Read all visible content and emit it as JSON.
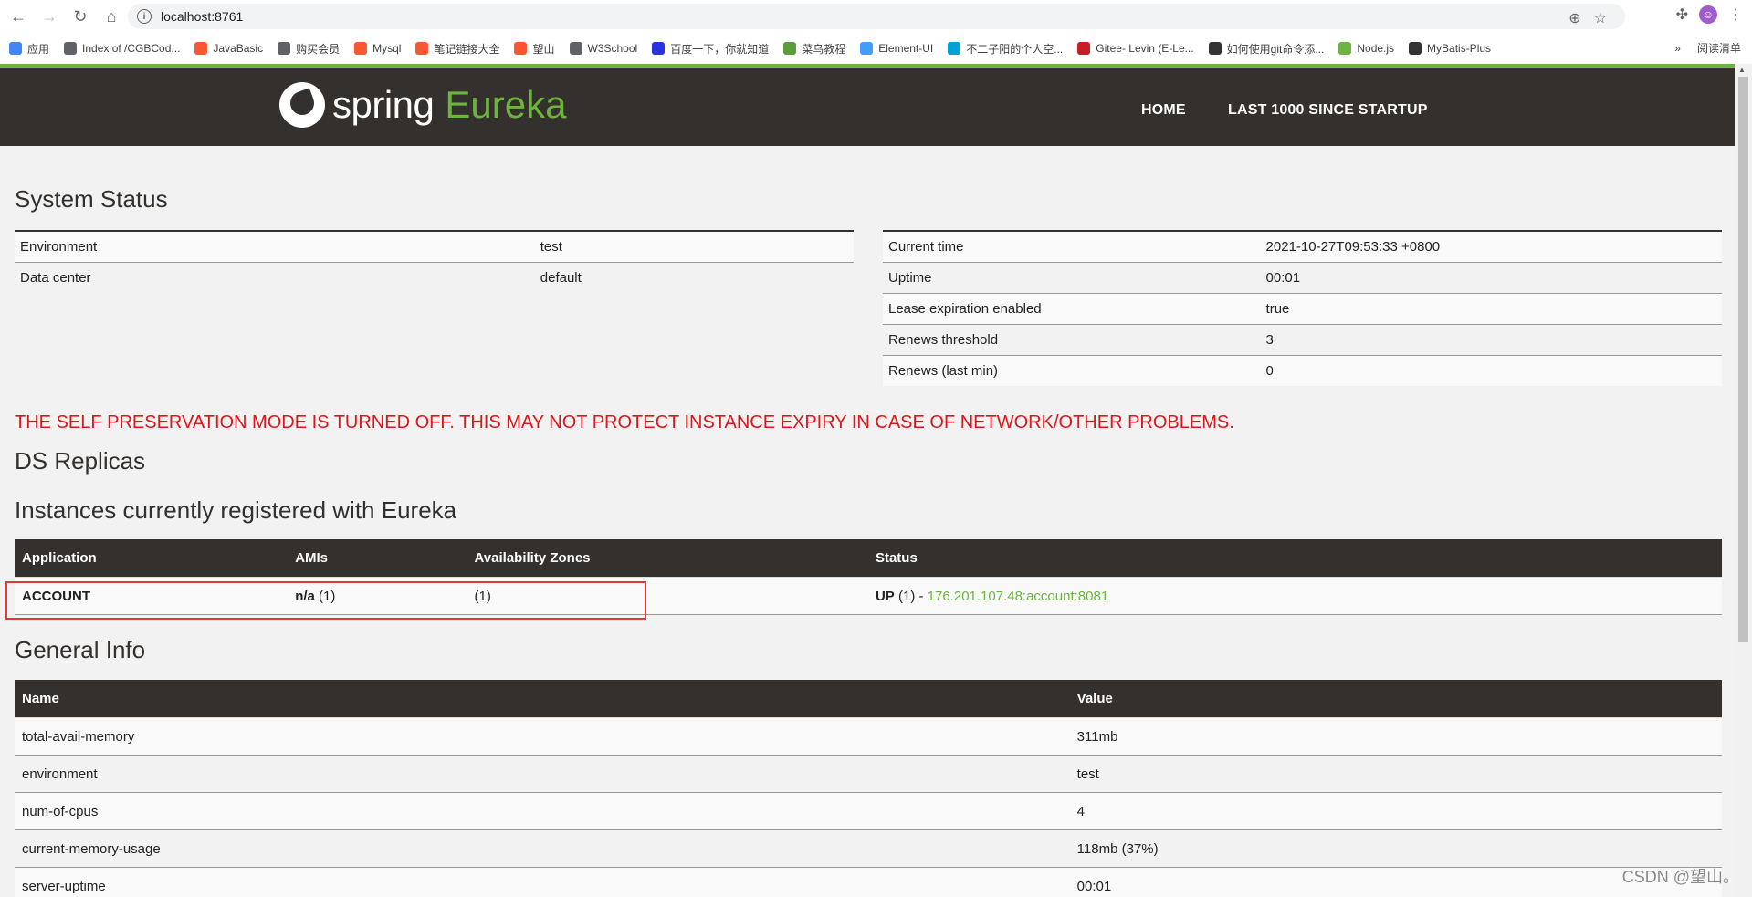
{
  "browser": {
    "url": "localhost:8761",
    "bookmarks": [
      {
        "label": "应用",
        "icon": "apps-icon",
        "color": "#4285f4"
      },
      {
        "label": "Index of /CGBCod...",
        "icon": "globe-icon",
        "color": "#5f6368"
      },
      {
        "label": "JavaBasic",
        "icon": "csdn-icon",
        "color": "#fc5531"
      },
      {
        "label": "购买会员",
        "icon": "globe-icon",
        "color": "#5f6368"
      },
      {
        "label": "Mysql",
        "icon": "csdn-icon",
        "color": "#fc5531"
      },
      {
        "label": "笔记链接大全",
        "icon": "csdn-icon",
        "color": "#fc5531"
      },
      {
        "label": "望山",
        "icon": "csdn-icon",
        "color": "#fc5531"
      },
      {
        "label": "W3School",
        "icon": "globe-icon",
        "color": "#5f6368"
      },
      {
        "label": "百度一下，你就知道",
        "icon": "baidu-icon",
        "color": "#2932e1"
      },
      {
        "label": "菜鸟教程",
        "icon": "runoob-icon",
        "color": "#5a9e3b"
      },
      {
        "label": "Element-UI",
        "icon": "element-icon",
        "color": "#409eff"
      },
      {
        "label": "不二子阳的个人空...",
        "icon": "bilibili-icon",
        "color": "#00a1d6"
      },
      {
        "label": "Gitee- Levin (E-Le...",
        "icon": "gitee-icon",
        "color": "#c71d23"
      },
      {
        "label": "如何使用git命令添...",
        "icon": "git-icon",
        "color": "#333333"
      },
      {
        "label": "Node.js",
        "icon": "nodejs-icon",
        "color": "#6db33f"
      },
      {
        "label": "MyBatis-Plus",
        "icon": "mybatis-icon",
        "color": "#333333"
      }
    ],
    "reading_list": "阅读清单",
    "more": "»"
  },
  "header": {
    "logo_spring": "spring",
    "logo_eureka": "Eureka",
    "nav": [
      "HOME",
      "LAST 1000 SINCE STARTUP"
    ]
  },
  "system_status": {
    "title": "System Status",
    "left": [
      {
        "k": "Environment",
        "v": "test"
      },
      {
        "k": "Data center",
        "v": "default"
      }
    ],
    "right": [
      {
        "k": "Current time",
        "v": "2021-10-27T09:53:33 +0800"
      },
      {
        "k": "Uptime",
        "v": "00:01"
      },
      {
        "k": "Lease expiration enabled",
        "v": "true"
      },
      {
        "k": "Renews threshold",
        "v": "3"
      },
      {
        "k": "Renews (last min)",
        "v": "0"
      }
    ]
  },
  "warning": "THE SELF PRESERVATION MODE IS TURNED OFF. THIS MAY NOT PROTECT INSTANCE EXPIRY IN CASE OF NETWORK/OTHER PROBLEMS.",
  "ds_replicas": "DS Replicas",
  "instances": {
    "title": "Instances currently registered with Eureka",
    "headers": [
      "Application",
      "AMIs",
      "Availability Zones",
      "Status"
    ],
    "rows": [
      {
        "app": "ACCOUNT",
        "ami": "n/a",
        "ami_count": "(1)",
        "zones": "(1)",
        "status": "UP",
        "status_count": "(1) - ",
        "link": "176.201.107.48:account:8081"
      }
    ]
  },
  "general_info": {
    "title": "General Info",
    "headers": [
      "Name",
      "Value"
    ],
    "rows": [
      {
        "k": "total-avail-memory",
        "v": "311mb"
      },
      {
        "k": "environment",
        "v": "test"
      },
      {
        "k": "num-of-cpus",
        "v": "4"
      },
      {
        "k": "current-memory-usage",
        "v": "118mb (37%)"
      },
      {
        "k": "server-uptime",
        "v": "00:01"
      }
    ]
  },
  "watermark": "CSDN @望山。"
}
